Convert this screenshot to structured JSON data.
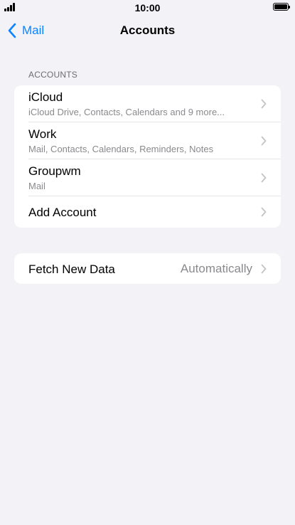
{
  "status_bar": {
    "time": "10:00"
  },
  "nav": {
    "back_label": "Mail",
    "title": "Accounts"
  },
  "accounts_section": {
    "header": "ACCOUNTS",
    "items": [
      {
        "title": "iCloud",
        "subtitle": "iCloud Drive, Contacts, Calendars and 9 more..."
      },
      {
        "title": "Work",
        "subtitle": "Mail, Contacts, Calendars, Reminders, Notes"
      },
      {
        "title": "Groupwm",
        "subtitle": "Mail"
      }
    ],
    "add_account_label": "Add Account"
  },
  "fetch": {
    "label": "Fetch New Data",
    "value": "Automatically"
  },
  "colors": {
    "accent": "#0a84ff",
    "background": "#f2f2f7",
    "secondary_text": "#8a8a8e"
  },
  "icons": {
    "back": "chevron-left-icon",
    "disclosure": "chevron-right-icon",
    "signal": "cellular-signal-icon",
    "battery": "battery-icon"
  }
}
